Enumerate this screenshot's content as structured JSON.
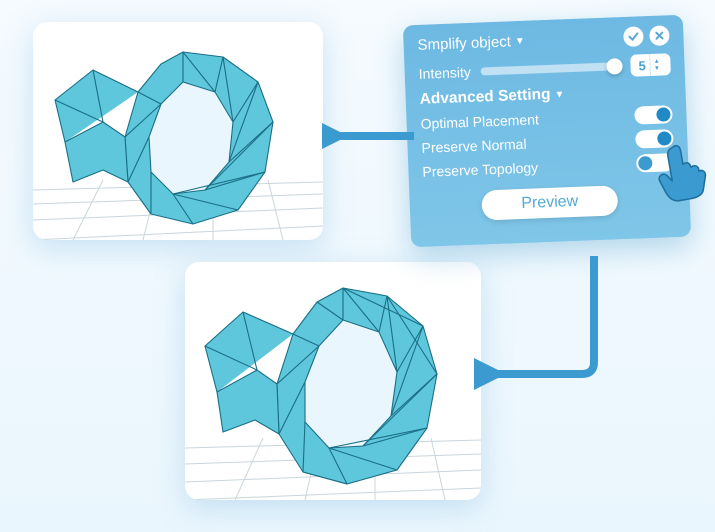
{
  "panel": {
    "title": "Smplify object",
    "intensity": {
      "label": "Intensity",
      "value": "5"
    },
    "advanced_label": "Advanced Setting",
    "settings": [
      {
        "label": "Optimal Placement",
        "on": true
      },
      {
        "label": "Preserve  Normal",
        "on": true
      },
      {
        "label": "Preserve  Topology",
        "on": false
      }
    ],
    "preview_label": "Preview"
  },
  "icons": {
    "confirm": "confirm-icon",
    "close": "close-icon",
    "dropdown": "dropdown-triangle-icon",
    "pointer": "pointer-hand-icon"
  },
  "arrows": {
    "to_top_preview": "arrow",
    "to_bottom_preview": "arrow"
  },
  "previews": {
    "top": {
      "desc": "low-poly torus mesh render (before)"
    },
    "bottom": {
      "desc": "low-poly torus mesh render (after/simplified)"
    }
  },
  "colors": {
    "panel_bg": "#6db9e3",
    "accent": "#3b9ad0",
    "mesh_fill": "#5ec7db",
    "mesh_edge": "#1a6f86"
  }
}
